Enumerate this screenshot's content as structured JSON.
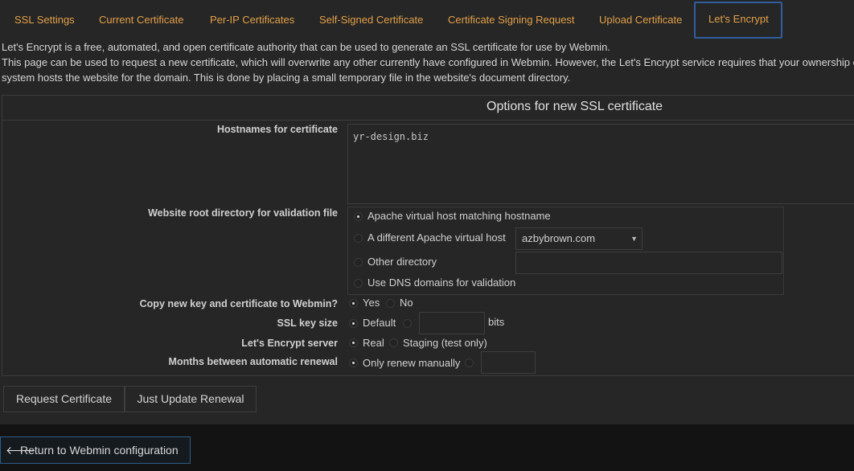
{
  "tabs": [
    {
      "label": "SSL Settings"
    },
    {
      "label": "Current Certificate"
    },
    {
      "label": "Per-IP Certificates"
    },
    {
      "label": "Self-Signed Certificate"
    },
    {
      "label": "Certificate Signing Request"
    },
    {
      "label": "Upload Certificate"
    },
    {
      "label": "Let's Encrypt"
    }
  ],
  "active_tab": "Let's Encrypt",
  "description": {
    "line1": "Let's Encrypt is a free, automated, and open certificate authority that can be used to generate an SSL certificate for use by Webmin.",
    "line2": "This page can be used to request a new certificate, which will overwrite any other currently have configured in Webmin. However, the Let's Encrypt service requires that your ownership of",
    "line3": "system hosts the website for the domain. This is done by placing a small temporary file in the website's document directory."
  },
  "form": {
    "title": "Options for new SSL certificate",
    "hostnames": {
      "label": "Hostnames for certificate",
      "value": "yr-design.biz"
    },
    "webroot": {
      "label": "Website root directory for validation file",
      "options": {
        "apache_match": "Apache virtual host matching hostname",
        "apache_other": "A different Apache virtual host",
        "other_dir": "Other directory",
        "dns": "Use DNS domains for validation"
      },
      "selected": "apache_match",
      "vhost_select_value": "azbybrown.com",
      "other_dir_value": ""
    },
    "copy": {
      "label": "Copy new key and certificate to Webmin?",
      "yes": "Yes",
      "no": "No",
      "selected": "yes"
    },
    "keysize": {
      "label": "SSL key size",
      "default": "Default",
      "unit": "bits",
      "value": "",
      "selected": "default"
    },
    "server": {
      "label": "Let's Encrypt server",
      "real": "Real",
      "staging": "Staging (test only)",
      "selected": "real"
    },
    "renewal": {
      "label": "Months between automatic renewal",
      "manual": "Only renew manually",
      "value": "",
      "selected": "manual"
    }
  },
  "buttons": {
    "request": "Request Certificate",
    "update": "Just Update Renewal"
  },
  "footer": {
    "return_label": "Return to Webmin configuration",
    "return_icon": "arrow-left-icon"
  },
  "colors": {
    "tab_text": "#e3a048",
    "active_tab_border": "#2f5f9f",
    "background": "#262626",
    "footer_bg": "#131313"
  }
}
